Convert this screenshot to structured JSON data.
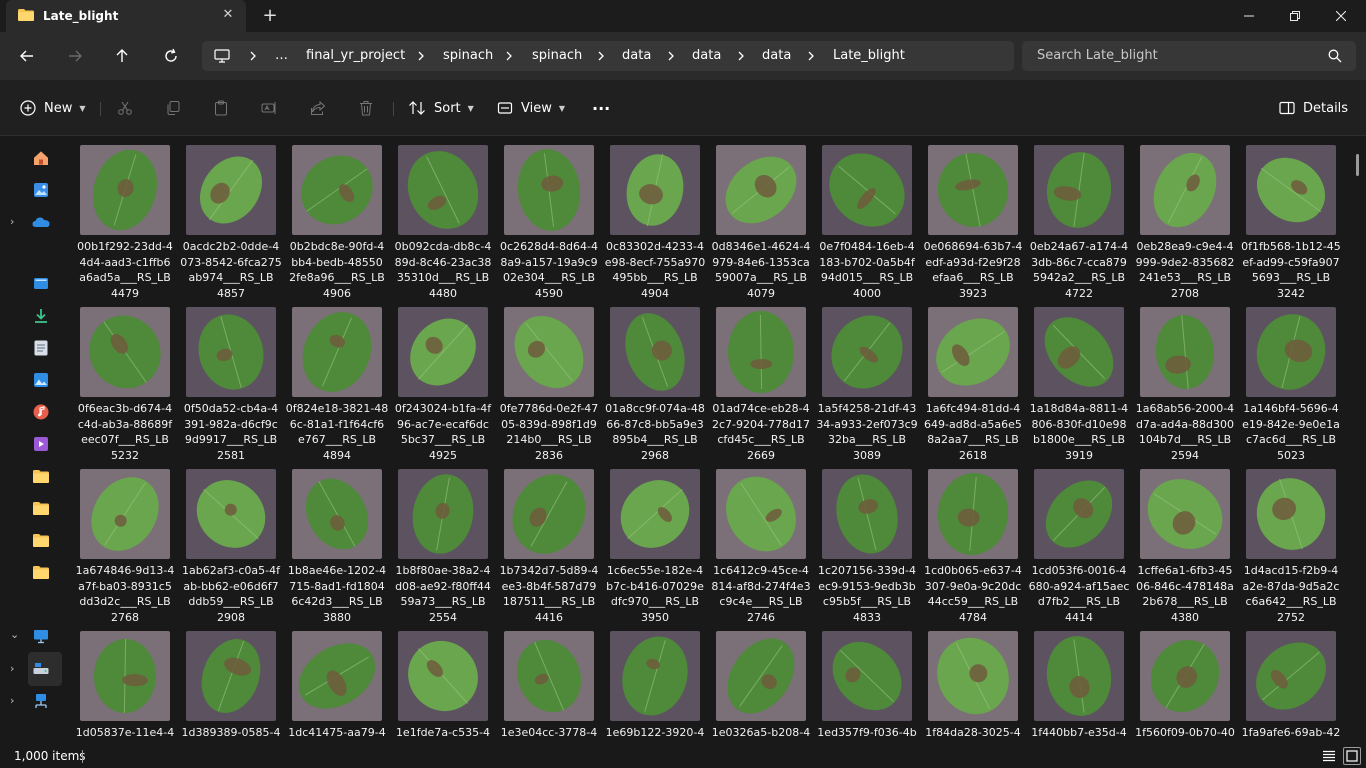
{
  "window": {
    "tab_title": "Late_blight",
    "close_tab_symbol": "✕",
    "new_tab_symbol": "+"
  },
  "address": {
    "breadcrumbs": [
      "…",
      "final_yr_project",
      "spinach",
      "spinach",
      "data",
      "data",
      "data",
      "Late_blight"
    ],
    "search_placeholder": "Search Late_blight"
  },
  "toolbar": {
    "new_label": "New",
    "sort_label": "Sort",
    "view_label": "View",
    "more_label": "···",
    "details_label": "Details"
  },
  "nav_icons": [
    "home-icon",
    "gallery-icon",
    "onedrive-icon",
    "desktop-icon",
    "downloads-icon",
    "documents-icon",
    "pictures-icon",
    "music-icon",
    "videos-icon",
    "folder-icon",
    "folder-icon",
    "folder-icon",
    "folder-icon",
    "this-pc-icon",
    "local-disk-icon",
    "network-icon"
  ],
  "files": [
    {
      "line1": "00b1f292-23dd-4",
      "line2": "4d4-aad3-c1ffb6",
      "line3": "a6ad5a___RS_LB",
      "line4": "4479"
    },
    {
      "line1": "0acdc2b2-0dde-4",
      "line2": "073-8542-6fca275",
      "line3": "ab974___RS_LB",
      "line4": "4857"
    },
    {
      "line1": "0b2bdc8e-90fd-4",
      "line2": "bb4-bedb-48550",
      "line3": "2fe8a96___RS_LB",
      "line4": "4906"
    },
    {
      "line1": "0b092cda-db8c-4",
      "line2": "89d-8c46-23ac38",
      "line3": "35310d___RS_LB",
      "line4": "4480"
    },
    {
      "line1": "0c2628d4-8d64-4",
      "line2": "8a9-a157-19a9c9",
      "line3": "02e304___RS_LB",
      "line4": "4590"
    },
    {
      "line1": "0c83302d-4233-4",
      "line2": "e98-8ecf-755a970",
      "line3": "495bb___RS_LB",
      "line4": "4904"
    },
    {
      "line1": "0d8346e1-4624-4",
      "line2": "979-84e6-1353ca",
      "line3": "59007a___RS_LB",
      "line4": "4079"
    },
    {
      "line1": "0e7f0484-16eb-4",
      "line2": "183-b702-0a5b4f",
      "line3": "94d015___RS_LB",
      "line4": "4000"
    },
    {
      "line1": "0e068694-63b7-4",
      "line2": "edf-a93d-f2e9f28",
      "line3": "efaa6___RS_LB",
      "line4": "3923"
    },
    {
      "line1": "0eb24a67-a174-4",
      "line2": "3db-86c7-cca879",
      "line3": "5942a2___RS_LB",
      "line4": "4722"
    },
    {
      "line1": "0eb28ea9-c9e4-4",
      "line2": "999-9de2-835682",
      "line3": "241e53___RS_LB",
      "line4": "2708"
    },
    {
      "line1": "0f1fb568-1b12-45",
      "line2": "ef-ad99-c59fa907",
      "line3": "5693___RS_LB",
      "line4": "3242"
    },
    {
      "line1": "0f6eac3b-d674-4",
      "line2": "c4d-ab3a-88689f",
      "line3": "eec07f___RS_LB",
      "line4": "5232"
    },
    {
      "line1": "0f50da52-cb4a-4",
      "line2": "391-982a-d6cf9c",
      "line3": "9d9917___RS_LB",
      "line4": "2581"
    },
    {
      "line1": "0f824e18-3821-48",
      "line2": "6c-81a1-f1f64cf6",
      "line3": "e767___RS_LB",
      "line4": "4894"
    },
    {
      "line1": "0f243024-b1fa-4f",
      "line2": "96-ac7e-ecaf6dc",
      "line3": "5bc37___RS_LB",
      "line4": "4925"
    },
    {
      "line1": "0fe7786d-0e2f-47",
      "line2": "05-839d-898f1d9",
      "line3": "214b0___RS_LB",
      "line4": "2836"
    },
    {
      "line1": "01a8cc9f-074a-48",
      "line2": "66-87c8-bb5a9e3",
      "line3": "895b4___RS_LB",
      "line4": "2968"
    },
    {
      "line1": "01ad74ce-eb28-4",
      "line2": "2c7-9204-778d17",
      "line3": "cfd45c___RS_LB",
      "line4": "2669"
    },
    {
      "line1": "1a5f4258-21df-43",
      "line2": "34-a933-2ef073c9",
      "line3": "32ba___RS_LB",
      "line4": "3089"
    },
    {
      "line1": "1a6fc494-81dd-4",
      "line2": "649-ad8d-a5a6e5",
      "line3": "8a2aa7___RS_LB",
      "line4": "2618"
    },
    {
      "line1": "1a18d84a-8811-4",
      "line2": "806-830f-d10e98",
      "line3": "b1800e___RS_LB",
      "line4": "3919"
    },
    {
      "line1": "1a68ab56-2000-4",
      "line2": "d7a-ad4a-88d300",
      "line3": "104b7d___RS_LB",
      "line4": "2594"
    },
    {
      "line1": "1a146bf4-5696-4",
      "line2": "e19-842e-9e0e1a",
      "line3": "c7ac6d___RS_LB",
      "line4": "5023"
    },
    {
      "line1": "1a674846-9d13-4",
      "line2": "a7f-ba03-8931c5",
      "line3": "dd3d2c___RS_LB",
      "line4": "2768"
    },
    {
      "line1": "1ab62af3-c0a5-4f",
      "line2": "ab-bb62-e06d6f7",
      "line3": "ddb59___RS_LB",
      "line4": "2908"
    },
    {
      "line1": "1b8ae46e-1202-4",
      "line2": "715-8ad1-fd1804",
      "line3": "6c42d3___RS_LB",
      "line4": "3880"
    },
    {
      "line1": "1b8f80ae-38a2-4",
      "line2": "d08-ae92-f80ff44",
      "line3": "59a73___RS_LB",
      "line4": "2554"
    },
    {
      "line1": "1b7342d7-5d89-4",
      "line2": "ee3-8b4f-587d79",
      "line3": "187511___RS_LB",
      "line4": "4416"
    },
    {
      "line1": "1c6ec55e-182e-4",
      "line2": "b7c-b416-07029e",
      "line3": "dfc970___RS_LB",
      "line4": "3950"
    },
    {
      "line1": "1c6412c9-45ce-4",
      "line2": "814-af8d-274f4e3",
      "line3": "c9c4e___RS_LB",
      "line4": "2746"
    },
    {
      "line1": "1c207156-339d-4",
      "line2": "ec9-9153-9edb3b",
      "line3": "c95b5f___RS_LB",
      "line4": "4833"
    },
    {
      "line1": "1cd0b065-e637-4",
      "line2": "307-9e0a-9c20dc",
      "line3": "44cc59___RS_LB",
      "line4": "4784"
    },
    {
      "line1": "1cd053f6-0016-4",
      "line2": "680-a924-af15aec",
      "line3": "d7fb2___RS_LB",
      "line4": "4414"
    },
    {
      "line1": "1cffe6a1-6fb3-45",
      "line2": "06-846c-478148a",
      "line3": "2b678___RS_LB",
      "line4": "4380"
    },
    {
      "line1": "1d4acd15-f2b9-4",
      "line2": "a2e-87da-9d5a2c",
      "line3": "c6a642___RS_LB",
      "line4": "2752"
    },
    {
      "line1": "1d05837e-11e4-4",
      "line2": "",
      "line3": "",
      "line4": ""
    },
    {
      "line1": "1d389389-0585-4",
      "line2": "",
      "line3": "",
      "line4": ""
    },
    {
      "line1": "1dc41475-aa79-4",
      "line2": "",
      "line3": "",
      "line4": ""
    },
    {
      "line1": "1e1fde7a-c535-4",
      "line2": "",
      "line3": "",
      "line4": ""
    },
    {
      "line1": "1e3e04cc-3778-4",
      "line2": "",
      "line3": "",
      "line4": ""
    },
    {
      "line1": "1e69b122-3920-4",
      "line2": "",
      "line3": "",
      "line4": ""
    },
    {
      "line1": "1e0326a5-b208-4",
      "line2": "",
      "line3": "",
      "line4": ""
    },
    {
      "line1": "1ed357f9-f036-4b",
      "line2": "",
      "line3": "",
      "line4": ""
    },
    {
      "line1": "1f84da28-3025-4",
      "line2": "",
      "line3": "",
      "line4": ""
    },
    {
      "line1": "1f440bb7-e35d-4",
      "line2": "",
      "line3": "",
      "line4": ""
    },
    {
      "line1": "1f560f09-0b70-40",
      "line2": "",
      "line3": "",
      "line4": ""
    },
    {
      "line1": "1fa9afe6-69ab-42",
      "line2": "",
      "line3": "",
      "line4": ""
    }
  ],
  "status": {
    "item_count": "1,000 items"
  },
  "colors": {
    "leaf": "#4e8a3a",
    "leaf_light": "#6aa64e",
    "lesion": "#6e5a3c",
    "background_a": "#7b6f78",
    "background_b": "#5c5260"
  }
}
